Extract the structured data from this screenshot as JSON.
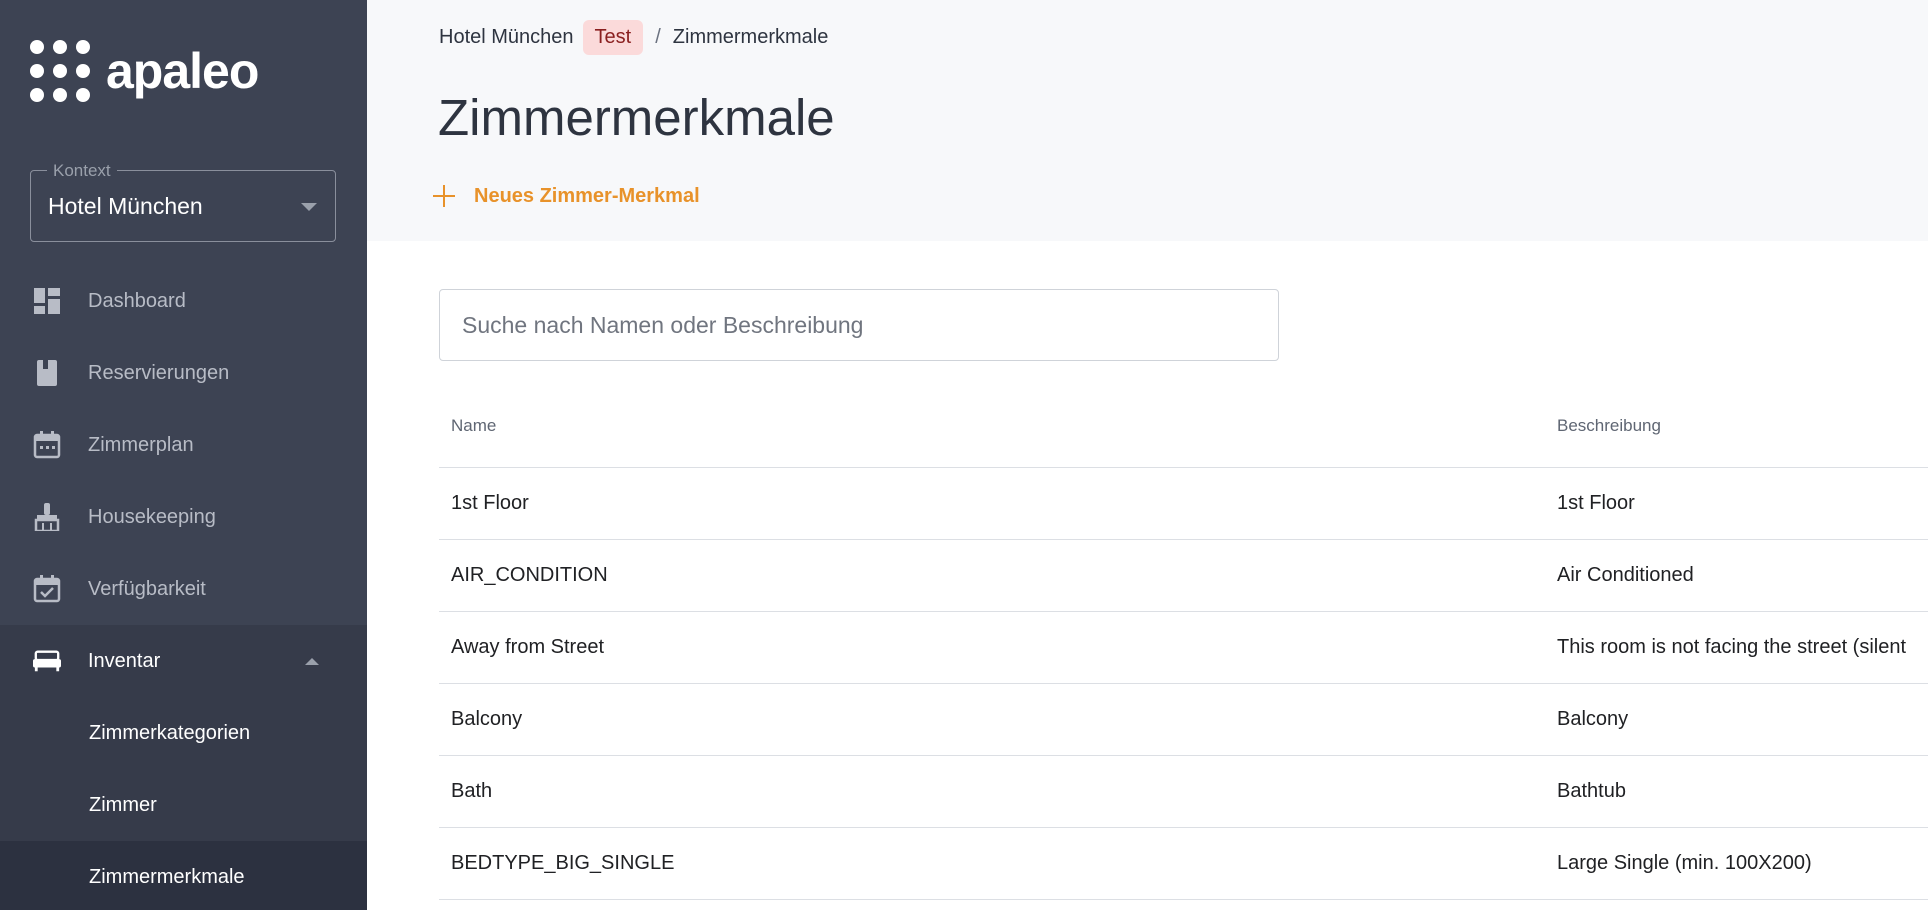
{
  "sidebar": {
    "logo_text": "apaleo",
    "context": {
      "label": "Kontext",
      "value": "Hotel München"
    },
    "nav": [
      {
        "label": "Dashboard",
        "icon": "dashboard-icon"
      },
      {
        "label": "Reservierungen",
        "icon": "book-icon"
      },
      {
        "label": "Zimmerplan",
        "icon": "calendar-icon"
      },
      {
        "label": "Housekeeping",
        "icon": "broom-icon"
      },
      {
        "label": "Verfügbarkeit",
        "icon": "calendar-check-icon"
      },
      {
        "label": "Inventar",
        "icon": "bed-icon"
      }
    ],
    "sub_items": [
      {
        "label": "Zimmerkategorien"
      },
      {
        "label": "Zimmer"
      },
      {
        "label": "Zimmermerkmale"
      }
    ]
  },
  "header": {
    "breadcrumb": {
      "property": "Hotel München",
      "badge": "Test",
      "separator": "/",
      "current": "Zimmermerkmale"
    },
    "title": "Zimmermerkmale",
    "new_button": "Neues Zimmer-Merkmal"
  },
  "search": {
    "placeholder": "Suche nach Namen oder Beschreibung",
    "value": ""
  },
  "table": {
    "columns": [
      "Name",
      "Beschreibung"
    ],
    "rows": [
      {
        "name": "1st Floor",
        "description": "1st Floor"
      },
      {
        "name": "AIR_CONDITION",
        "description": "Air Conditioned"
      },
      {
        "name": "Away from Street",
        "description": "This room is not facing the street (silent"
      },
      {
        "name": "Balcony",
        "description": "Balcony"
      },
      {
        "name": "Bath",
        "description": "Bathtub"
      },
      {
        "name": "BEDTYPE_BIG_SINGLE",
        "description": "Large Single (min. 100X200)"
      }
    ]
  },
  "colors": {
    "sidebar": "#3d4353",
    "accent": "#e8922a",
    "badge_bg": "#fbdada"
  }
}
